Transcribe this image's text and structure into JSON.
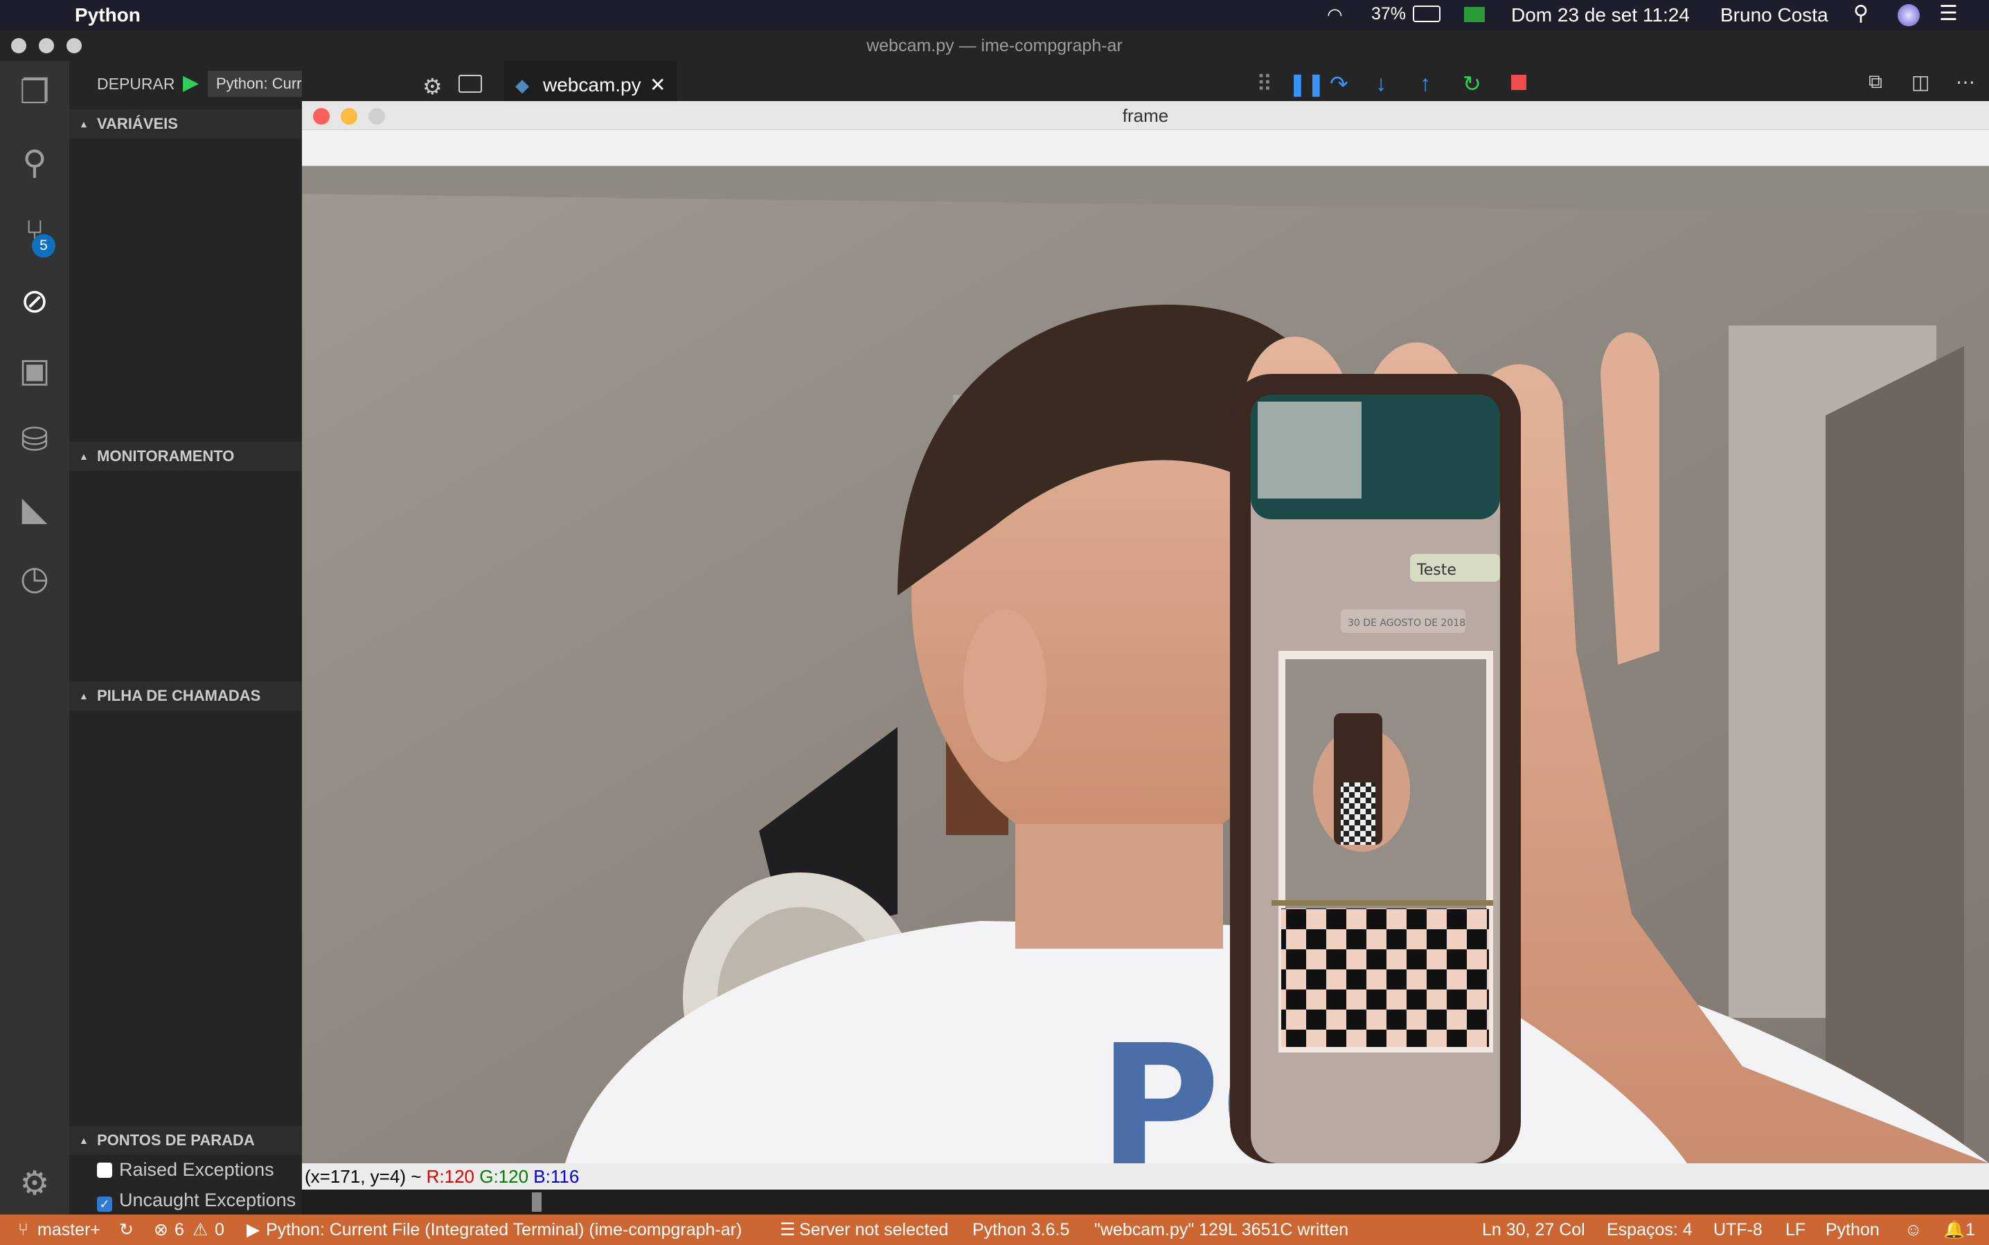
{
  "menubar": {
    "app_name": "Python",
    "battery": "37%",
    "datetime": "Dom 23 de set  11:24",
    "user": "Bruno Costa"
  },
  "window": {
    "title": "webcam.py — ime-compgraph-ar"
  },
  "debug": {
    "label": "DEPURAR",
    "config": "Python: Current File (In ↕"
  },
  "activity": {
    "source_control_badge": "5"
  },
  "sidebar": {
    "variables": "VARIÁVEIS",
    "watch": "MONITORAMENTO",
    "call_stack": "PILHA DE CHAMADAS",
    "breakpoints": "PONTOS DE PARADA",
    "bp_raised": "Raised Exceptions",
    "bp_uncaught": "Uncaught Exceptions"
  },
  "editor": {
    "tab_label": "webcam.py"
  },
  "frame_window": {
    "title": "frame",
    "coords": "(x=171, y=4) ~ ",
    "r": "R:120",
    "g": "G:120",
    "b": "B:116",
    "phone_msg": "Teste",
    "phone_date": "30 DE AGOSTO DE 2018"
  },
  "statusbar": {
    "branch": "master+",
    "errors": "6",
    "warnings": "0",
    "run": "Python: Current File (Integrated Terminal) (ime-compgraph-ar)",
    "server": "Server not selected",
    "interpreter": "Python 3.6.5",
    "written": "\"webcam.py\" 129L 3651C written",
    "position": "Ln 30, 27 Col",
    "spaces": "Espaços: 4",
    "encoding": "UTF-8",
    "eol": "LF",
    "language": "Python",
    "notifications": "1"
  },
  "colors": {
    "statusbar": "#cc6633",
    "accent": "#0e70c0",
    "red": "#e00000",
    "green": "#008000",
    "blue": "#0000e0"
  }
}
